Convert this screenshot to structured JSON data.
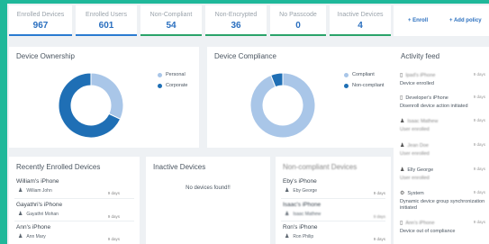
{
  "stats": [
    {
      "label": "Enrolled Devices",
      "value": "967"
    },
    {
      "label": "Enrolled Users",
      "value": "601"
    },
    {
      "label": "Non-Compliant",
      "value": "54"
    },
    {
      "label": "Non-Encrypted",
      "value": "36"
    },
    {
      "label": "No Passcode",
      "value": "0"
    },
    {
      "label": "Inactive Devices",
      "value": "4"
    }
  ],
  "actions": {
    "enroll": "+ Enroll",
    "add_policy": "+ Add policy"
  },
  "ownership": {
    "title": "Device Ownership",
    "legend": [
      {
        "label": "Personal",
        "color": "#a9c6e8"
      },
      {
        "label": "Corporate",
        "color": "#1f6fb5"
      }
    ],
    "chart_data": {
      "type": "pie",
      "categories": [
        "Personal",
        "Corporate"
      ],
      "values": [
        32,
        68
      ]
    }
  },
  "compliance": {
    "title": "Device Compliance",
    "legend": [
      {
        "label": "Compliant",
        "color": "#a9c6e8"
      },
      {
        "label": "Non-compliant",
        "color": "#1f6fb5"
      }
    ],
    "chart_data": {
      "type": "pie",
      "categories": [
        "Compliant",
        "Non-compliant"
      ],
      "values": [
        94,
        6
      ]
    }
  },
  "activity": {
    "title": "Activity feed",
    "items": [
      {
        "icon": "phone-icon",
        "head": "Ipad's iPhone",
        "time": "9 days",
        "desc": "Device enrolled"
      },
      {
        "icon": "phone-icon",
        "head": "Developer's iPhone",
        "time": "9 days",
        "desc": "Disenroll device action initiated"
      },
      {
        "icon": "user-icon",
        "head": "Isaac Mathew",
        "time": "9 days",
        "desc": "User enrolled"
      },
      {
        "icon": "user-icon",
        "head": "Jean Doe",
        "time": "9 days",
        "desc": "User enrolled"
      },
      {
        "icon": "user-icon",
        "head": "Elly George",
        "time": "9 days",
        "desc": "User enrolled"
      },
      {
        "icon": "gear-icon",
        "head": "System",
        "time": "9 days",
        "desc": "Dynamic device group synchronization initiated"
      },
      {
        "icon": "phone-icon",
        "head": "Ann's iPhone",
        "time": "9 days",
        "desc": "Device out of compliance"
      }
    ]
  },
  "recent": {
    "title": "Recently Enrolled Devices",
    "items": [
      {
        "name": "William's iPhone",
        "user": "William John",
        "time": "9 days"
      },
      {
        "name": "Gayathri's iPhone",
        "user": "Gayathri Mohan",
        "time": "9 days"
      },
      {
        "name": "Ann's iPhone",
        "user": "Ann Mary",
        "time": "9 days"
      }
    ]
  },
  "inactive": {
    "title": "Inactive Devices",
    "empty": "No devices found!!"
  },
  "noncompliant": {
    "title": "Non-compliant Devices",
    "items": [
      {
        "name": "Eby's iPhone",
        "user": "Eby George",
        "time": "9 days"
      },
      {
        "name": "Isaac's iPhone",
        "user": "Isaac Mathew",
        "time": "9 days"
      },
      {
        "name": "Ron's iPhone",
        "user": "Ron Philip",
        "time": "9 days"
      }
    ]
  }
}
